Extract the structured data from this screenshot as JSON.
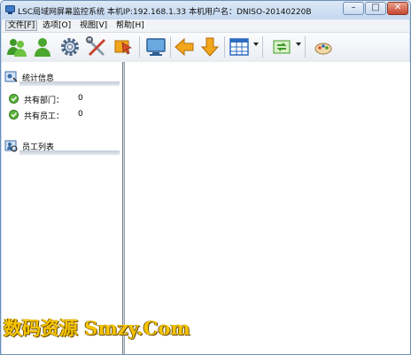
{
  "window": {
    "title": "LSC局域网屏幕监控系统    本机IP:192.168.1.33    本机用户名：DNISO-20140220B",
    "controls": {
      "minimize": "–",
      "maximize": "□",
      "close": "✕"
    }
  },
  "menu": [
    {
      "label": "文件[F]"
    },
    {
      "label": "选项[O]"
    },
    {
      "label": "视图[V]"
    },
    {
      "label": "帮助[H]"
    }
  ],
  "toolbar": {
    "icons": [
      "users-green-icon",
      "user-green-icon",
      "gear-icon",
      "tools-icon",
      "cursor-icon",
      "monitor-icon",
      "arrow-left-icon",
      "arrow-down-icon",
      "grid-view-icon",
      "refresh-icon",
      "paint-icon"
    ],
    "colors": {
      "green": "#3f9a2a",
      "orange": "#f2a61c",
      "blue": "#2d6bbf"
    }
  },
  "sidebar": {
    "stats_section_title": "统计信息",
    "stats": [
      {
        "label": "共有部门：",
        "value": "0"
      },
      {
        "label": "共有员工：",
        "value": "0"
      }
    ],
    "employee_section_title": "员工列表"
  },
  "watermark": "数码资源 Smzy.Com"
}
